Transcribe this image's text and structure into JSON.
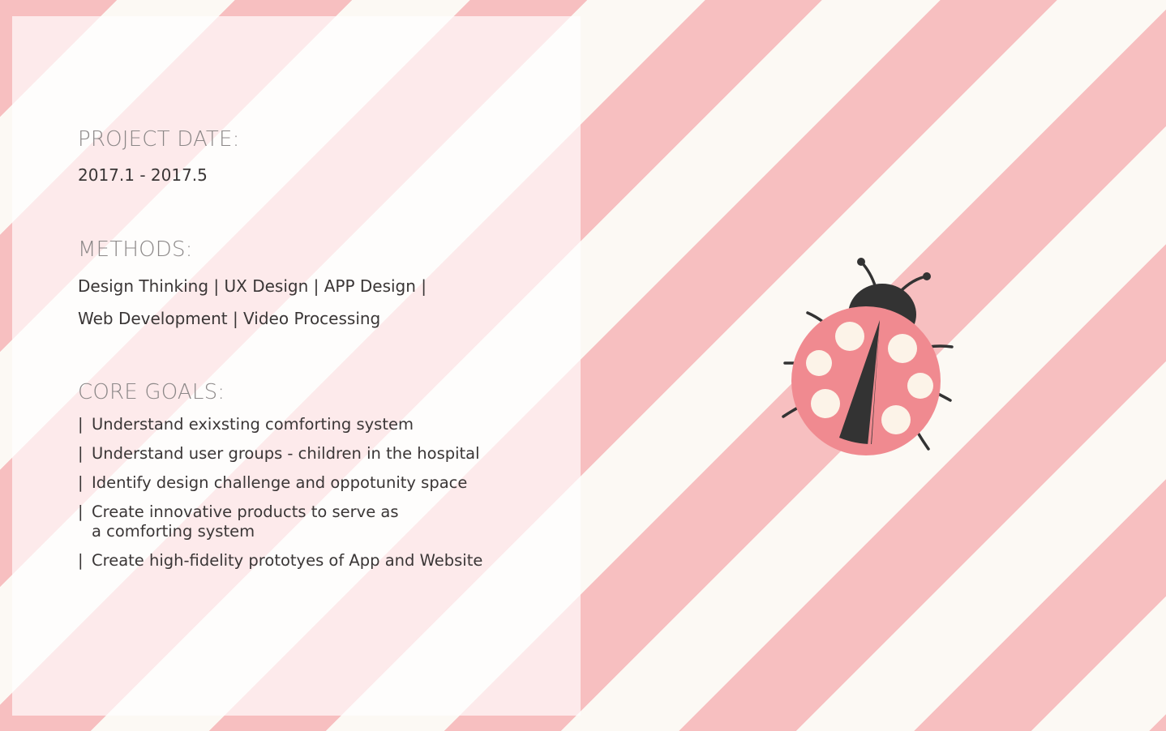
{
  "colors": {
    "stripe_pink": "#f7bfc0",
    "stripe_cream": "#fcf9f4",
    "heading_gray": "#8b8787",
    "text_dark": "#3a3636",
    "ladybug_shell": "#f08a90",
    "ladybug_dark": "#333333",
    "ladybug_spots": "#fcf3e8"
  },
  "project_date": {
    "title": "PROJECT DATE:",
    "value": "2017.1 - 2017.5"
  },
  "methods": {
    "title": "METHODS:",
    "line1": "Design Thinking | UX Design | APP Design |",
    "line2": "Web Development | Video Processing"
  },
  "core_goals": {
    "title": "CORE GOALS:",
    "bullet": "|",
    "items": [
      "Understand exixsting comforting system",
      "Understand user groups - children in the hospital",
      "Identify design challenge and oppotunity space",
      "Create innovative products to serve as\na comforting system",
      "Create high-fidelity prototyes of App and Website"
    ]
  },
  "illustration": {
    "icon": "ladybug-icon"
  }
}
